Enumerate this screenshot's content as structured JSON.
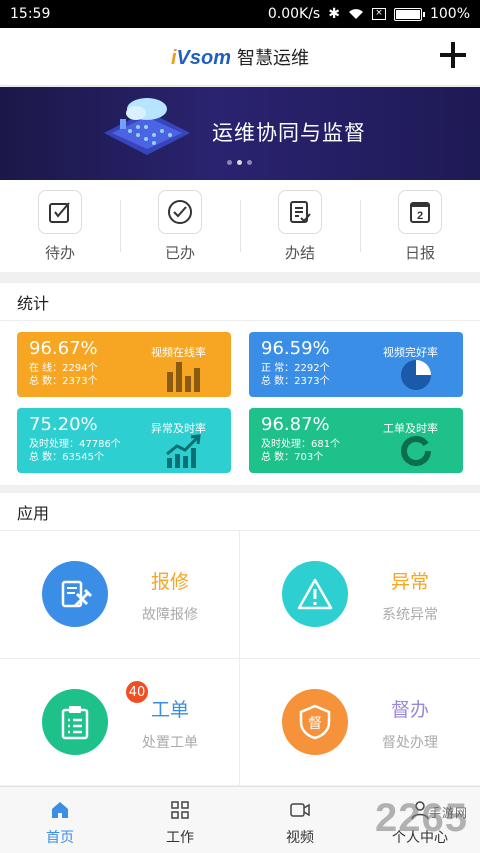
{
  "status_bar": {
    "time": "15:59",
    "speed": "0.00K/s",
    "battery": "100%",
    "battery_level": 1.0
  },
  "header": {
    "logo_prefix": "i",
    "logo_rest": "Vsom",
    "title": "智慧运维",
    "add_icon": "plus-icon"
  },
  "banner": {
    "text": "运维协同与监督",
    "pages": 3,
    "active_page": 2
  },
  "quick_actions": [
    {
      "label": "待办",
      "icon": "edit-check-icon"
    },
    {
      "label": "已办",
      "icon": "check-circle-icon"
    },
    {
      "label": "办结",
      "icon": "list-check-icon"
    },
    {
      "label": "日报",
      "icon": "calendar-2-icon",
      "icon_text": "2"
    }
  ],
  "stats": {
    "title": "统计",
    "cards": [
      {
        "percent": "96.67%",
        "name": "视频在线率",
        "line1": "在    线：2294个",
        "line2": "总    数：2373个",
        "color": "#f6a623",
        "icon": "bar-chart-icon"
      },
      {
        "percent": "96.59%",
        "name": "视频完好率",
        "line1": "正    常：2292个",
        "line2": "总    数：2373个",
        "color": "#3a8ee6",
        "icon": "pie-chart-icon"
      },
      {
        "percent": "75.20%",
        "name": "异常及时率",
        "line1": "及时处理：47786个",
        "line2": "总    数：63545个",
        "color": "#2ecfd0",
        "icon": "trend-chart-icon"
      },
      {
        "percent": "96.87%",
        "name": "工单及时率",
        "line1": "及时处理：681个",
        "line2": "总    数：703个",
        "color": "#1ec18a",
        "icon": "ring-chart-icon"
      }
    ]
  },
  "apps": {
    "title": "应用",
    "items": [
      {
        "title": "报修",
        "subtitle": "故障报修",
        "color": "#3a8ee6",
        "title_color": "#f6a623",
        "icon": "repair-tools-icon"
      },
      {
        "title": "异常",
        "subtitle": "系统异常",
        "color": "#2ecfd0",
        "title_color": "#f6a623",
        "icon": "warning-icon"
      },
      {
        "title": "工单",
        "subtitle": "处置工单",
        "color": "#1ec18a",
        "title_color": "#3a8ee6",
        "icon": "clipboard-icon",
        "badge": "40"
      },
      {
        "title": "督办",
        "subtitle": "督处办理",
        "color": "#f6923a",
        "title_color": "#9b88d8",
        "icon": "shield-du-icon",
        "icon_text": "督"
      }
    ]
  },
  "tabbar": [
    {
      "label": "首页",
      "icon": "home-icon",
      "active": true
    },
    {
      "label": "工作",
      "icon": "grid-icon",
      "active": false
    },
    {
      "label": "视频",
      "icon": "video-icon",
      "active": false
    },
    {
      "label": "个人中心",
      "icon": "user-icon",
      "active": false
    }
  ],
  "watermark": {
    "text": "2265",
    "sub": "手游网"
  }
}
